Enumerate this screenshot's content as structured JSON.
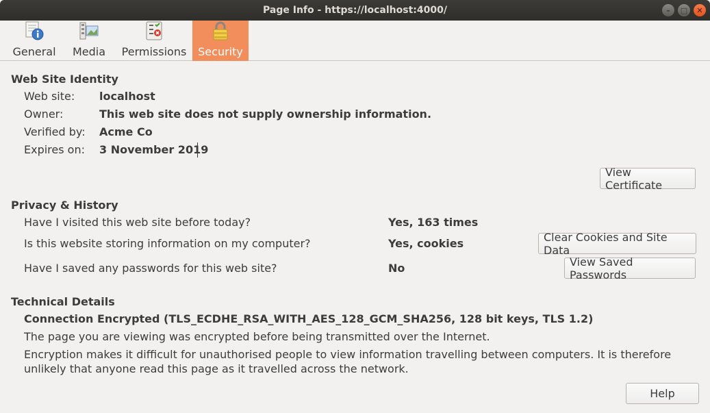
{
  "window": {
    "title": "Page Info - https://localhost:4000/"
  },
  "tabs": [
    {
      "label": "General",
      "icon": "info-icon"
    },
    {
      "label": "Media",
      "icon": "media-icon"
    },
    {
      "label": "Permissions",
      "icon": "permissions-icon"
    },
    {
      "label": "Security",
      "icon": "padlock-icon",
      "active": true
    }
  ],
  "identity": {
    "heading": "Web Site Identity",
    "website_label": "Web site:",
    "website_value": "localhost",
    "owner_label": "Owner:",
    "owner_value": "This web site does not supply ownership information.",
    "verified_label": "Verified by:",
    "verified_value": "Acme Co",
    "expires_label": "Expires on:",
    "expires_value": "3 November 2019",
    "view_cert_button": "View Certificate"
  },
  "privacy": {
    "heading": "Privacy & History",
    "visited_q": "Have I visited this web site before today?",
    "visited_a": "Yes, 163 times",
    "storing_q": "Is this website storing information on my computer?",
    "storing_a": "Yes, cookies",
    "clear_button": "Clear Cookies and Site Data",
    "passwords_q": "Have I saved any passwords for this web site?",
    "passwords_a": "No",
    "view_passwords_button": "View Saved Passwords"
  },
  "technical": {
    "heading": "Technical Details",
    "connection": "Connection Encrypted (TLS_ECDHE_RSA_WITH_AES_128_GCM_SHA256, 128 bit keys, TLS 1.2)",
    "line1": "The page you are viewing was encrypted before being transmitted over the Internet.",
    "line2a": "Encryption makes it difficult for unauthorised people to view information travelling between computers. It is therefore",
    "line2b": "unlikely that anyone read this page as it travelled across the network."
  },
  "help_button": "Help",
  "colors": {
    "active_tab": "#f28e5c",
    "titlebar": "#3c3b37"
  }
}
